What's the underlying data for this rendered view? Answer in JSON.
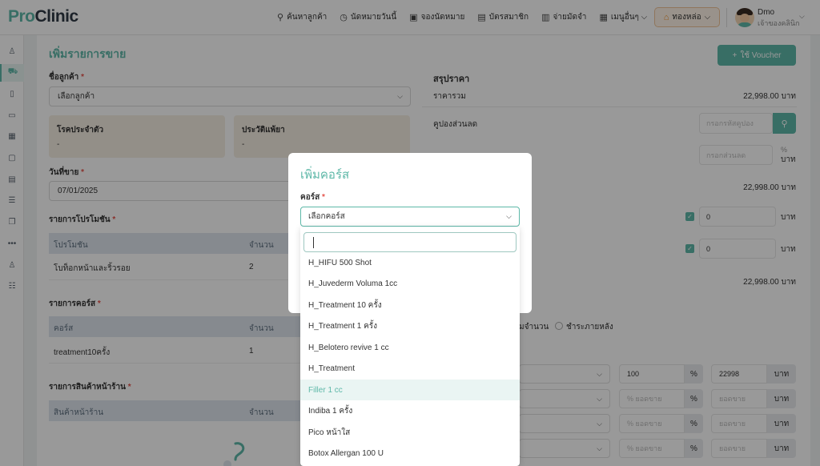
{
  "app": {
    "logo_pro": "Pro",
    "logo_clinic": "Clinic"
  },
  "nav": [
    {
      "icon": "user-search-icon",
      "glyph": "⚲",
      "label": "ค้นหาลูกค้า"
    },
    {
      "icon": "clock-icon",
      "glyph": "◷",
      "label": "นัดหมายวันนี้"
    },
    {
      "icon": "calendar-icon",
      "glyph": "▣",
      "label": "จองนัดหมาย"
    },
    {
      "icon": "id-card-icon",
      "glyph": "▤",
      "label": "บัตรสมาชิก"
    },
    {
      "icon": "document-icon",
      "glyph": "▥",
      "label": "จ่ายมัดจำ"
    },
    {
      "icon": "grid-icon",
      "glyph": "▦",
      "label": "เมนูอื่นๆ ⌵"
    }
  ],
  "branch": {
    "label": "ทองหล่อ",
    "caret": "⌵"
  },
  "user": {
    "name": "Dmo",
    "role": "เจ้าของคลินิก",
    "caret": "⌵"
  },
  "sidebar_icons": [
    {
      "name": "user-icon",
      "glyph": "♙"
    },
    {
      "name": "cart-icon",
      "glyph": "⛟"
    },
    {
      "name": "file-icon",
      "glyph": "▯"
    },
    {
      "name": "bag-icon",
      "glyph": "▭"
    },
    {
      "name": "gift-icon",
      "glyph": "▦"
    },
    {
      "name": "bookmark-icon",
      "glyph": "▢"
    },
    {
      "name": "calendar-icon",
      "glyph": "▤"
    },
    {
      "name": "database-icon",
      "glyph": "☰"
    },
    {
      "name": "copy-icon",
      "glyph": "❐"
    },
    {
      "name": "more-icon",
      "glyph": "•••"
    },
    {
      "name": "user-settings-icon",
      "glyph": "♙"
    },
    {
      "name": "checklist-icon",
      "glyph": "☷"
    }
  ],
  "page": {
    "title": "เพิ่มรายการขาย",
    "voucher_button": "ใช้ Voucher",
    "voucher_plus": "+"
  },
  "form": {
    "customer_label": "ชื่อลูกค้า",
    "customer_placeholder": "เลือกลูกค้า",
    "required_mark": "*",
    "disease_title": "โรคประจำตัว",
    "disease_value": "-",
    "allergy_title": "ประวัติแพ้ยา",
    "allergy_value": "-",
    "sale_date_label": "วันที่ขาย",
    "sale_date_value": "07/01/2025",
    "promotions_label": "รายการโปรโมชัน",
    "promotions_header": [
      "โปรโมชัน",
      "จำนวน"
    ],
    "promotions_rows": [
      [
        "โบท็อกหน้าและริ้วรอย",
        "2"
      ]
    ],
    "courses_label": "รายการคอร์ส",
    "courses_header": [
      "คอร์ส",
      "จำนวน"
    ],
    "courses_rows": [
      [
        "treatment10ครั้ง",
        "1"
      ]
    ],
    "products_label": "รายการสินค้าหน้าร้าน",
    "products_header": [
      "สินค้าหน้าร้าน",
      "จำนวน"
    ]
  },
  "summary": {
    "title": "สรุปราคา",
    "total_label": "ราคารวม",
    "total_value": "22,998.00 บาท",
    "coupon_label": "คูปองส่วนลด",
    "coupon_placeholder": "กรอกรหัสคูปอง",
    "discount_placeholder": "กรอกส่วนลด",
    "discount_pct": "%",
    "unit": "บาท",
    "subtotal_value": "22,998.00 บาท",
    "check_value_1": "0",
    "check_value_2": "0",
    "net_value": "22,998.00 บาท",
    "pay_option_1": "มจำนวน",
    "pay_option_2": "ชำระภายหลัง",
    "pay_rows": [
      {
        "pct": "100",
        "amount": "22998"
      },
      {
        "pct": "% ยอดขาย",
        "amount": "ยอดขาย"
      },
      {
        "pct": "% ยอดขาย",
        "amount": "ยอดขาย"
      },
      {
        "pct": "% ยอดขาย",
        "amount": "ยอดขาย"
      }
    ]
  },
  "modal": {
    "title": "เพิ่มคอร์ส",
    "course_label": "คอร์ส",
    "course_placeholder": "เลือกคอร์ส",
    "options": [
      "H_HIFU 500 Shot",
      "H_Juvederm Voluma 1cc",
      "H_Treatment 10 ครั้ง",
      "H_Treatment 1 ครั้ง",
      "H_Belotero revive 1 cc",
      "H_Treatment",
      "Filler 1 cc",
      "Indiba 1 ครั้ง",
      "Pico หน้าใส",
      "Botox Allergan 100 U"
    ],
    "highlighted_index": 6
  },
  "colors": {
    "accent": "#5eb8a8",
    "branch_bg": "#fff4e8",
    "info_bg": "#f6eee3",
    "table_head": "#dfe6ee",
    "required": "#e5534b"
  }
}
